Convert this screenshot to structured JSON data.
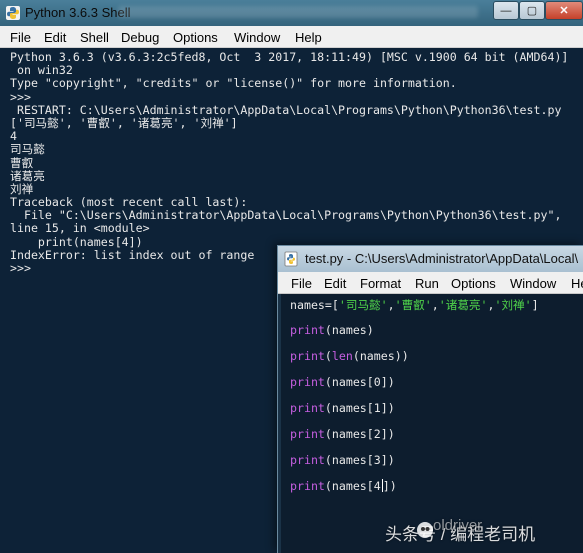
{
  "shell": {
    "title": "Python 3.6.3 Shell",
    "menu": [
      "File",
      "Edit",
      "Shell",
      "Debug",
      "Options",
      "Window",
      "Help"
    ],
    "lines": [
      {
        "cls": "c-out",
        "text": "Python 3.6.3 (v3.6.3:2c5fed8, Oct  3 2017, 18:11:49) [MSC v.1900 64 bit (AMD64)]"
      },
      {
        "cls": "c-out",
        "text": " on win32"
      },
      {
        "cls": "c-out",
        "text": "Type \"copyright\", \"credits\" or \"license()\" for more information."
      },
      {
        "cls": "c-prompt",
        "text": ">>> "
      },
      {
        "cls": "c-restart",
        "text": " RESTART: C:\\Users\\Administrator\\AppData\\Local\\Programs\\Python\\Python36\\test.py"
      },
      {
        "cls": "c-out",
        "text": "['司马懿', '曹叡', '诸葛亮', '刘禅']"
      },
      {
        "cls": "c-out",
        "text": "4"
      },
      {
        "cls": "c-out",
        "text": "司马懿"
      },
      {
        "cls": "c-out",
        "text": "曹叡"
      },
      {
        "cls": "c-out",
        "text": "诸葛亮"
      },
      {
        "cls": "c-out",
        "text": "刘禅"
      },
      {
        "cls": "c-err",
        "text": "Traceback (most recent call last):"
      },
      {
        "cls": "c-err",
        "text": "  File \"C:\\Users\\Administrator\\AppData\\Local\\Programs\\Python\\Python36\\test.py\","
      },
      {
        "cls": "c-err",
        "text": "line 15, in <module>"
      },
      {
        "cls": "c-err",
        "text": "    print(names[4])"
      },
      {
        "cls": "c-err",
        "text": "IndexError: list index out of range"
      },
      {
        "cls": "c-prompt",
        "text": ">>> "
      }
    ]
  },
  "editor": {
    "title": "test.py - C:\\Users\\Administrator\\AppData\\Local\\",
    "menu": [
      "File",
      "Edit",
      "Format",
      "Run",
      "Options",
      "Window",
      "He"
    ],
    "code": [
      {
        "tokens": [
          {
            "t": "names=[",
            "c": "tok-id"
          },
          {
            "t": "'司马懿'",
            "c": "tok-str"
          },
          {
            "t": ",",
            "c": "tok-id"
          },
          {
            "t": "'曹叡'",
            "c": "tok-str"
          },
          {
            "t": ",",
            "c": "tok-id"
          },
          {
            "t": "'诸葛亮'",
            "c": "tok-str"
          },
          {
            "t": ",",
            "c": "tok-id"
          },
          {
            "t": "'刘禅'",
            "c": "tok-str"
          },
          {
            "t": "]",
            "c": "tok-id"
          }
        ]
      },
      {
        "tokens": [
          {
            "t": "print",
            "c": "tok-kw"
          },
          {
            "t": "(names)",
            "c": "tok-id"
          }
        ]
      },
      {
        "tokens": [
          {
            "t": "print",
            "c": "tok-kw"
          },
          {
            "t": "(",
            "c": "tok-id"
          },
          {
            "t": "len",
            "c": "tok-kw"
          },
          {
            "t": "(names))",
            "c": "tok-id"
          }
        ]
      },
      {
        "tokens": [
          {
            "t": "print",
            "c": "tok-kw"
          },
          {
            "t": "(names[0])",
            "c": "tok-id"
          }
        ]
      },
      {
        "tokens": [
          {
            "t": "print",
            "c": "tok-kw"
          },
          {
            "t": "(names[1])",
            "c": "tok-id"
          }
        ]
      },
      {
        "tokens": [
          {
            "t": "print",
            "c": "tok-kw"
          },
          {
            "t": "(names[2])",
            "c": "tok-id"
          }
        ]
      },
      {
        "tokens": [
          {
            "t": "print",
            "c": "tok-kw"
          },
          {
            "t": "(names[3])",
            "c": "tok-id"
          }
        ]
      },
      {
        "tokens": [
          {
            "t": "print",
            "c": "tok-kw"
          },
          {
            "t": "(names[4",
            "c": "tok-id"
          },
          {
            "t": "",
            "c": "cursor"
          },
          {
            "t": "])",
            "c": "tok-id"
          }
        ]
      }
    ]
  },
  "watermark": {
    "text": "头条号 / 编程老司机",
    "overlay": "oldriver"
  },
  "colors": {
    "background": "#0d2237",
    "keyword": "#c55ee0",
    "string": "#4fd24a",
    "text": "#e8e8e8"
  }
}
